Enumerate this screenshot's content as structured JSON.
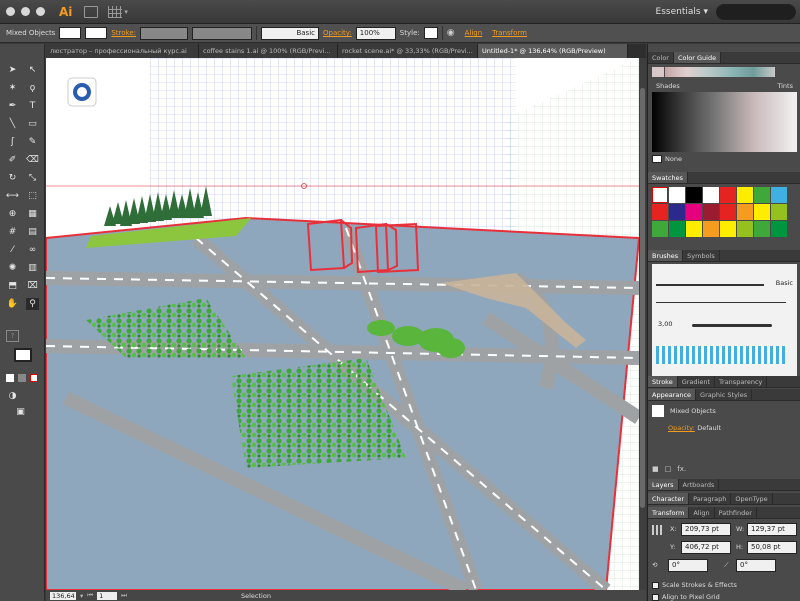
{
  "menubar": {
    "app_logo": "Ai",
    "workspace": "Essentials",
    "workspace_arrow": "▾",
    "search_placeholder": ""
  },
  "controlbar": {
    "selection_type": "Mixed Objects",
    "stroke_label": "Stroke:",
    "brush": "Basic",
    "opacity_label": "Opacity:",
    "opacity": "100%",
    "style_label": "Style:",
    "align": "Align",
    "transform": "Transform"
  },
  "tabs": [
    {
      "label": "люстратор – профессиональный курс.ai",
      "active": false
    },
    {
      "label": "coffee stains 1.ai @ 100% (RGB/Previ...",
      "active": false
    },
    {
      "label": "rocket scene.ai* @ 33,33% (RGB/Previ...",
      "active": false
    },
    {
      "label": "Untitled-1* @ 136,64% (RGB/Preview)",
      "active": true
    }
  ],
  "statusbar": {
    "zoom": "136,64",
    "page": "1",
    "tool": "Selection"
  },
  "panels": {
    "color_tabs": [
      "Color",
      "Color Guide"
    ],
    "shades": "Shades",
    "tints": "Tints",
    "none_label": "None",
    "swatches_tab": "Swatches",
    "brushes_tabs": [
      "Brushes",
      "Symbols"
    ],
    "brush_basic": "Basic",
    "brush_size": "3,00",
    "stroke_tabs": [
      "Stroke",
      "Gradient",
      "Transparency"
    ],
    "appearance_tabs": [
      "Appearance",
      "Graphic Styles"
    ],
    "appearance_title": "Mixed Objects",
    "opacity_label": "Opacity:",
    "opacity_value": "Default",
    "fx": "fx.",
    "layers_tabs": [
      "Layers",
      "Artboards"
    ],
    "char_tabs": [
      "Character",
      "Paragraph",
      "OpenType"
    ],
    "transform_tabs": [
      "Transform",
      "Align",
      "Pathfinder"
    ],
    "x_label": "X:",
    "x_value": "209,73 pt",
    "w_label": "W:",
    "w_value": "129,37 pt",
    "y_label": "Y:",
    "y_value": "406,72 pt",
    "h_label": "H:",
    "h_value": "50,08 pt",
    "angle": "0°",
    "shear": "0°",
    "scale_strokes": "Scale Strokes & Effects",
    "align_pixel": "Align to Pixel Grid"
  },
  "colors": {
    "accent_orange": "#f39c20",
    "selection_red": "#e8303a",
    "grid_blue": "#5a78d8",
    "ground_blue": "#8fa7bd",
    "road_gray": "#9ea2a5",
    "grass_green": "#3fa83a"
  }
}
